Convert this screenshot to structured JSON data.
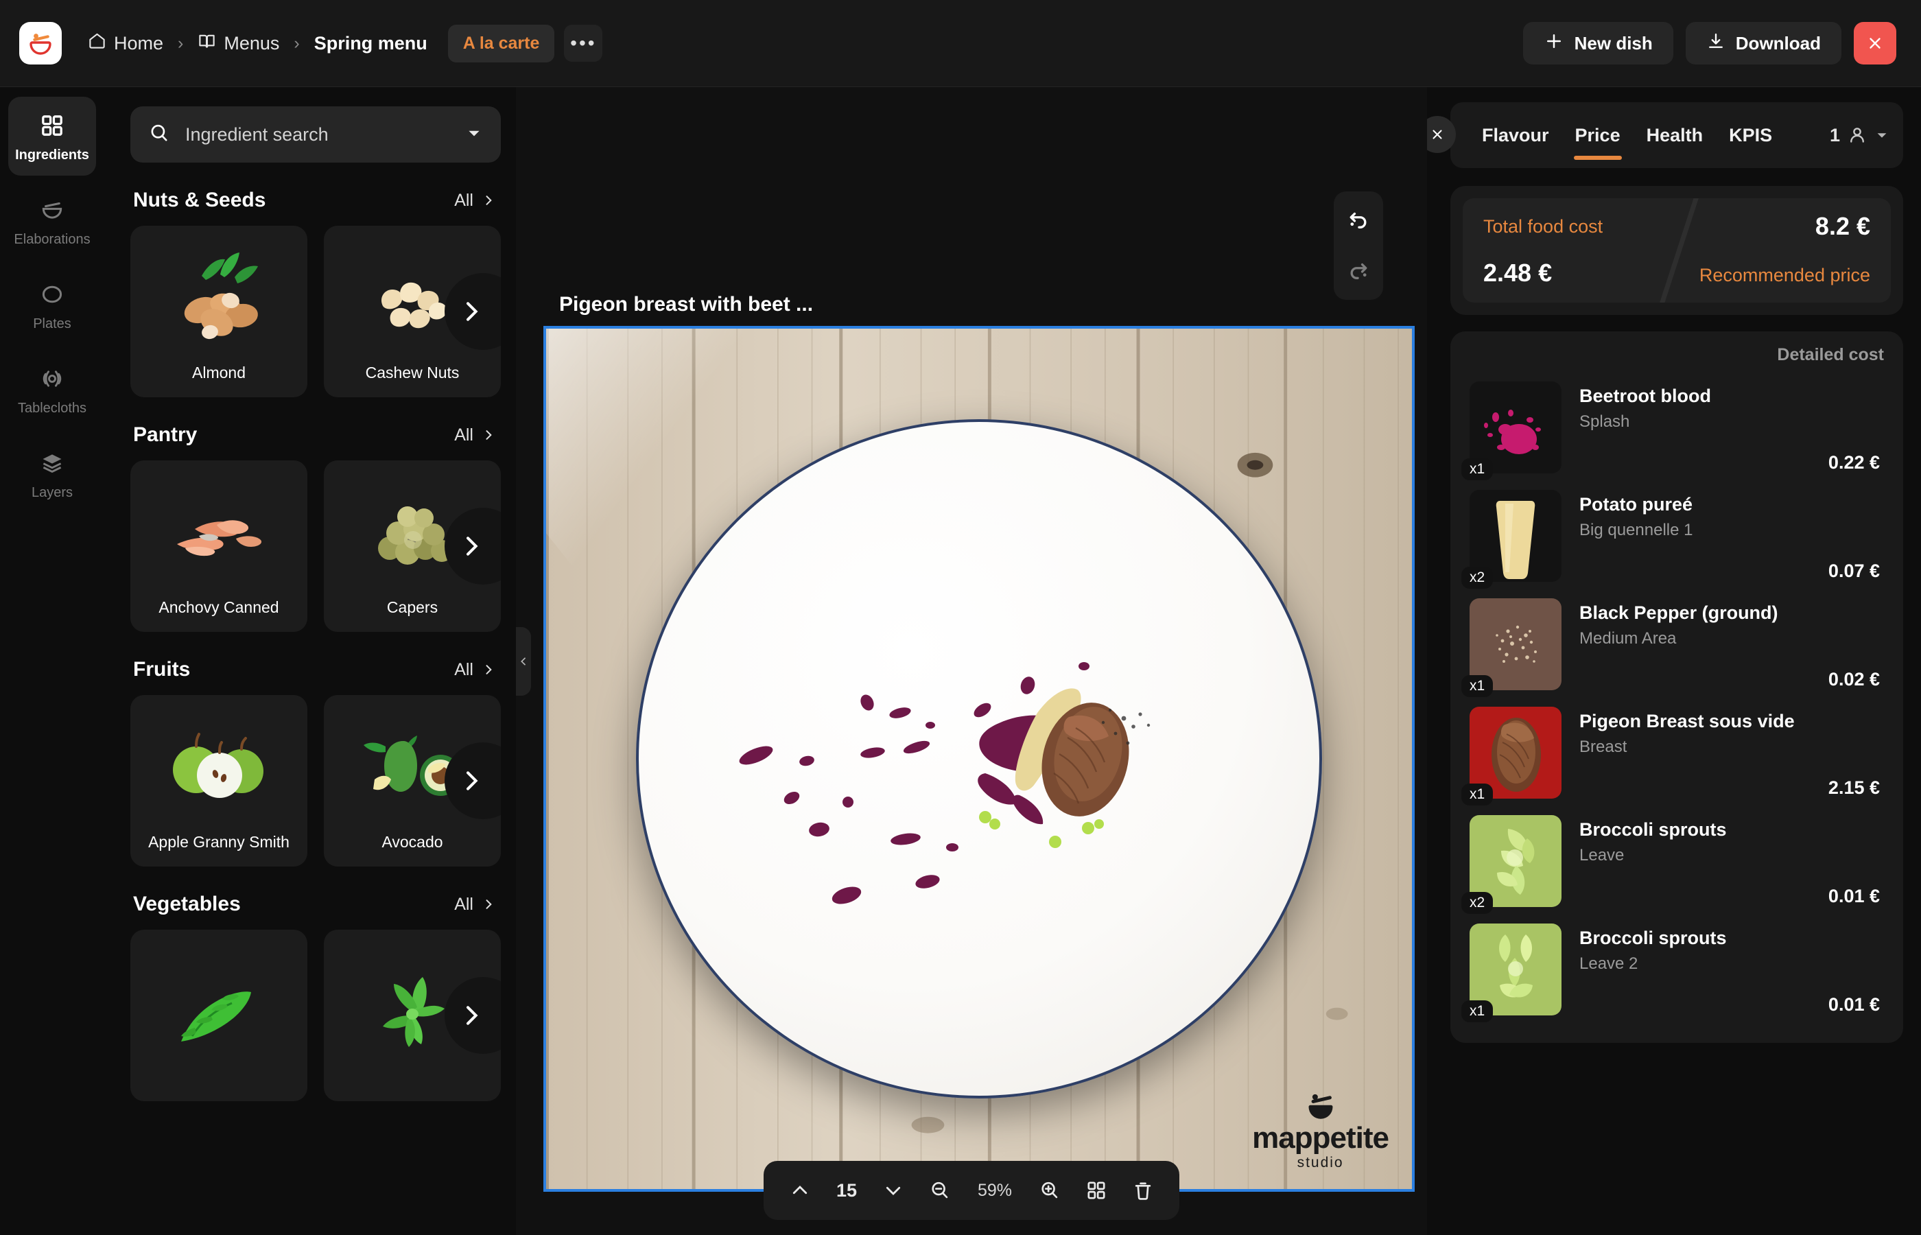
{
  "header": {
    "logo_name": "mortar-pestle-logo",
    "breadcrumbs": [
      {
        "label": "Home",
        "icon": "home-icon"
      },
      {
        "label": "Menus",
        "icon": "book-icon"
      },
      {
        "label": "Spring menu",
        "icon": ""
      }
    ],
    "separator": "›",
    "chip_label": "A la carte",
    "more_label": "•••",
    "new_dish_label": "New dish",
    "download_label": "Download",
    "close_label": "×",
    "accent_color": "#e8883f",
    "close_color": "#f1554f"
  },
  "rail": {
    "items": [
      {
        "label": "Ingredients",
        "icon": "grid-icon",
        "active": true
      },
      {
        "label": "Elaborations",
        "icon": "mortar-icon",
        "active": false
      },
      {
        "label": "Plates",
        "icon": "circle-icon",
        "active": false
      },
      {
        "label": "Tablecloths",
        "icon": "target-icon",
        "active": false
      },
      {
        "label": "Layers",
        "icon": "layers-icon",
        "active": false
      }
    ]
  },
  "ingredients": {
    "search": {
      "placeholder": "Ingredient search",
      "value": "",
      "icon": "search-icon",
      "dropdown_icon": "chevron-down-icon"
    },
    "all_label": "All",
    "categories": [
      {
        "title": "Nuts & Seeds",
        "items": [
          {
            "name": "Almond",
            "image": "almond-image"
          },
          {
            "name": "Cashew Nuts",
            "image": "cashew-nuts-image"
          }
        ]
      },
      {
        "title": "Pantry",
        "items": [
          {
            "name": "Anchovy Canned",
            "image": "anchovy-canned-image"
          },
          {
            "name": "Capers",
            "image": "capers-image"
          }
        ]
      },
      {
        "title": "Fruits",
        "items": [
          {
            "name": "Apple Granny Smith",
            "image": "apple-granny-smith-image"
          },
          {
            "name": "Avocado",
            "image": "avocado-image"
          }
        ]
      },
      {
        "title": "Vegetables",
        "items": [
          {
            "name": "",
            "image": "arugula-image"
          },
          {
            "name": "",
            "image": "basil-image"
          }
        ]
      }
    ]
  },
  "canvas": {
    "dish_title": "Pigeon breast with beet ...",
    "collapse_icon": "chevron-left-icon",
    "undo_icon": "undo-icon",
    "redo_icon": "redo-icon",
    "watermark_text": "mappetite",
    "watermark_sub": "studio",
    "selection_color": "#2b7fe0"
  },
  "bottombar": {
    "up_icon": "chevron-up-icon",
    "layer_value": "15",
    "down_icon": "chevron-down-icon",
    "zoom_out_icon": "zoom-out-icon",
    "zoom_value": "59%",
    "zoom_in_icon": "zoom-in-icon",
    "grid_icon": "grid-icon",
    "delete_icon": "trash-icon"
  },
  "right_panel": {
    "close_label": "×",
    "tabs": [
      {
        "label": "Flavour",
        "active": false
      },
      {
        "label": "Price",
        "active": true
      },
      {
        "label": "Health",
        "active": false
      },
      {
        "label": "KPIS",
        "active": false
      }
    ],
    "people_count": "1",
    "people_icon": "person-icon",
    "people_dropdown_icon": "chevron-down-icon",
    "cost": {
      "total_label": "Total food cost",
      "total_value": "8.2 €",
      "recommended_value": "2.48 €",
      "recommended_label": "Recommended price"
    },
    "detailed_title": "Detailed cost",
    "detailed_items": [
      {
        "name": "Beetroot blood",
        "desc": "Splash",
        "qty": "x1",
        "price": "0.22 €",
        "image": "beetroot-blood-image"
      },
      {
        "name": "Potato pureé",
        "desc": "Big quennelle 1",
        "qty": "x2",
        "price": "0.07 €",
        "image": "potato-puree-image"
      },
      {
        "name": "Black Pepper (ground)",
        "desc": "Medium Area",
        "qty": "x1",
        "price": "0.02 €",
        "image": "black-pepper-image"
      },
      {
        "name": "Pigeon Breast sous vide",
        "desc": "Breast",
        "qty": "x1",
        "price": "2.15 €",
        "image": "pigeon-breast-image"
      },
      {
        "name": "Broccoli sprouts",
        "desc": "Leave",
        "qty": "x2",
        "price": "0.01 €",
        "image": "broccoli-sprouts-image"
      },
      {
        "name": "Broccoli sprouts",
        "desc": "Leave 2",
        "qty": "x1",
        "price": "0.01 €",
        "image": "broccoli-sprouts-2-image"
      }
    ]
  }
}
